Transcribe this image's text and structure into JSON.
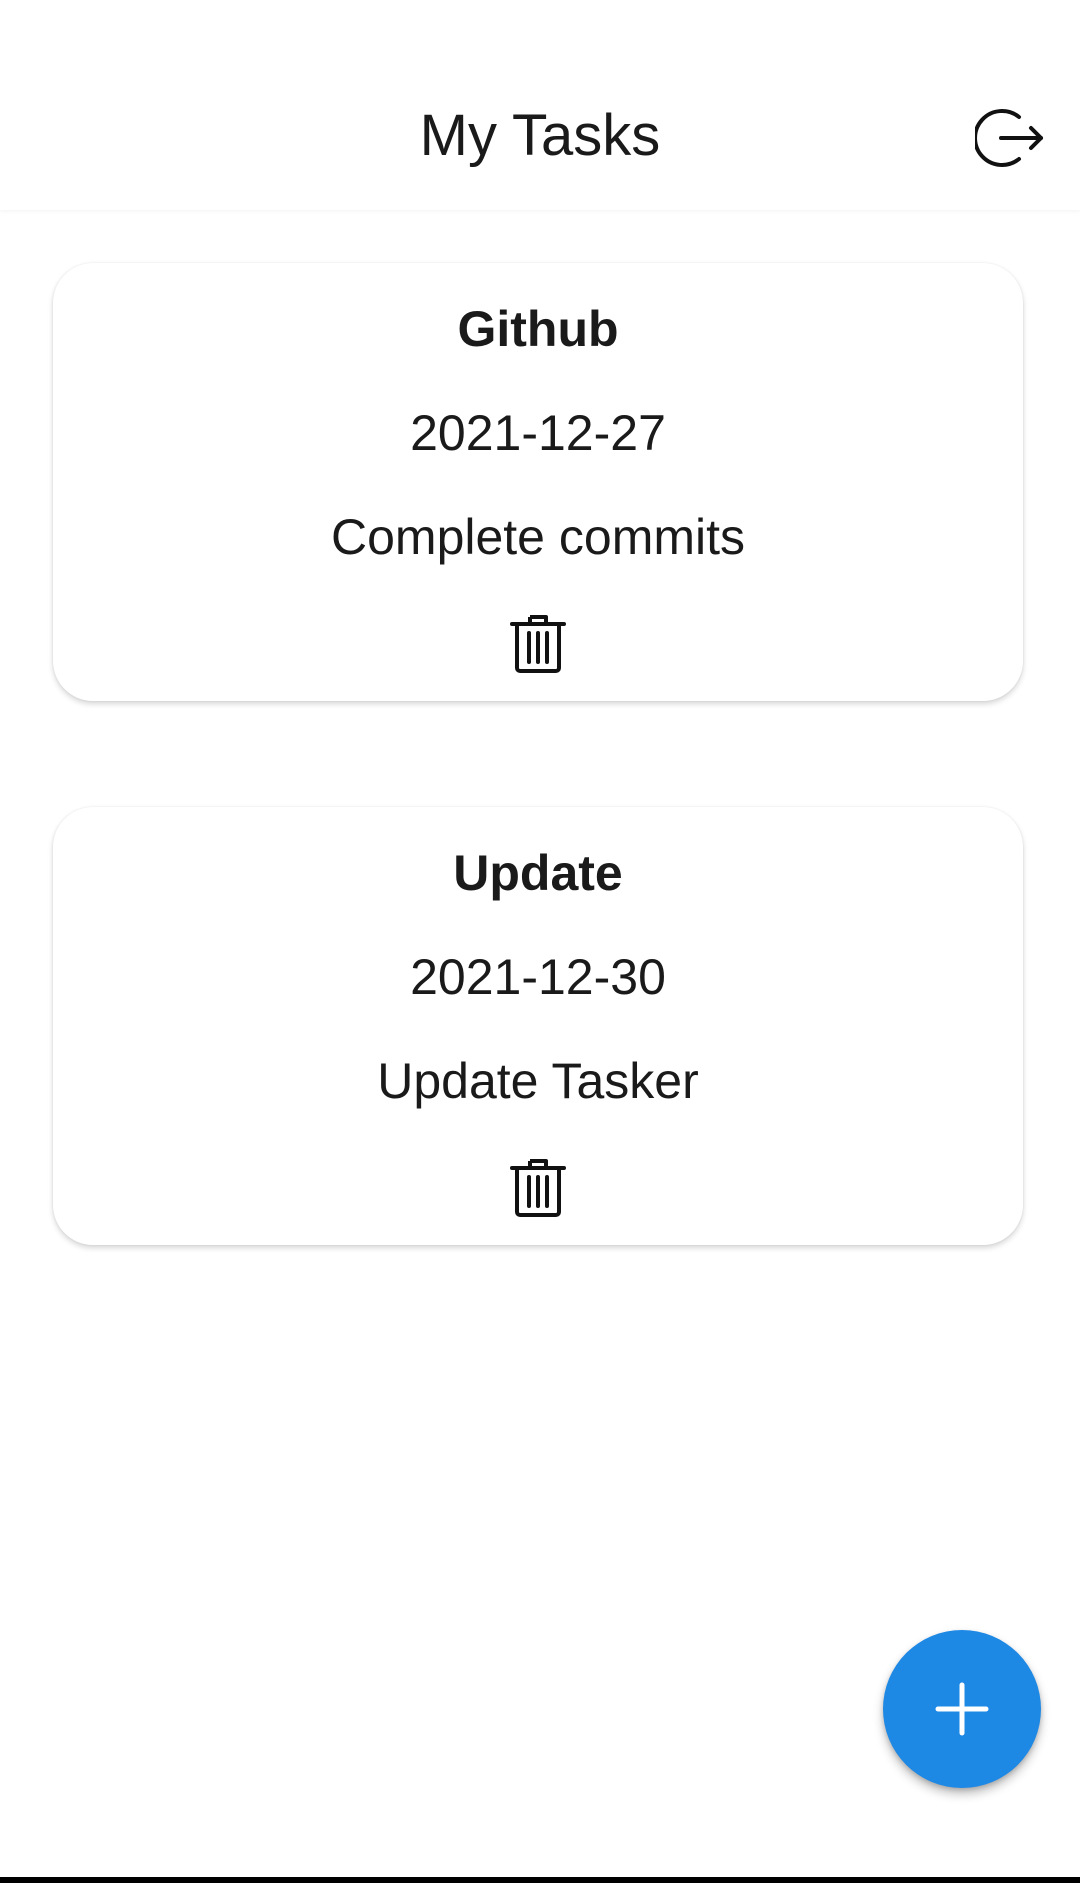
{
  "header": {
    "title": "My Tasks",
    "logout_icon": "logout-icon"
  },
  "tasks": [
    {
      "title": "Github",
      "date": "2021-12-27",
      "description": "Complete commits",
      "delete_icon": "trash-icon"
    },
    {
      "title": "Update",
      "date": "2021-12-30",
      "description": "Update Tasker",
      "delete_icon": "trash-icon"
    }
  ],
  "fab": {
    "icon": "plus-icon",
    "color": "#1E88E5"
  },
  "colors": {
    "background": "#FFFFFF",
    "text": "#1A1A1A",
    "accent": "#1E88E5"
  }
}
